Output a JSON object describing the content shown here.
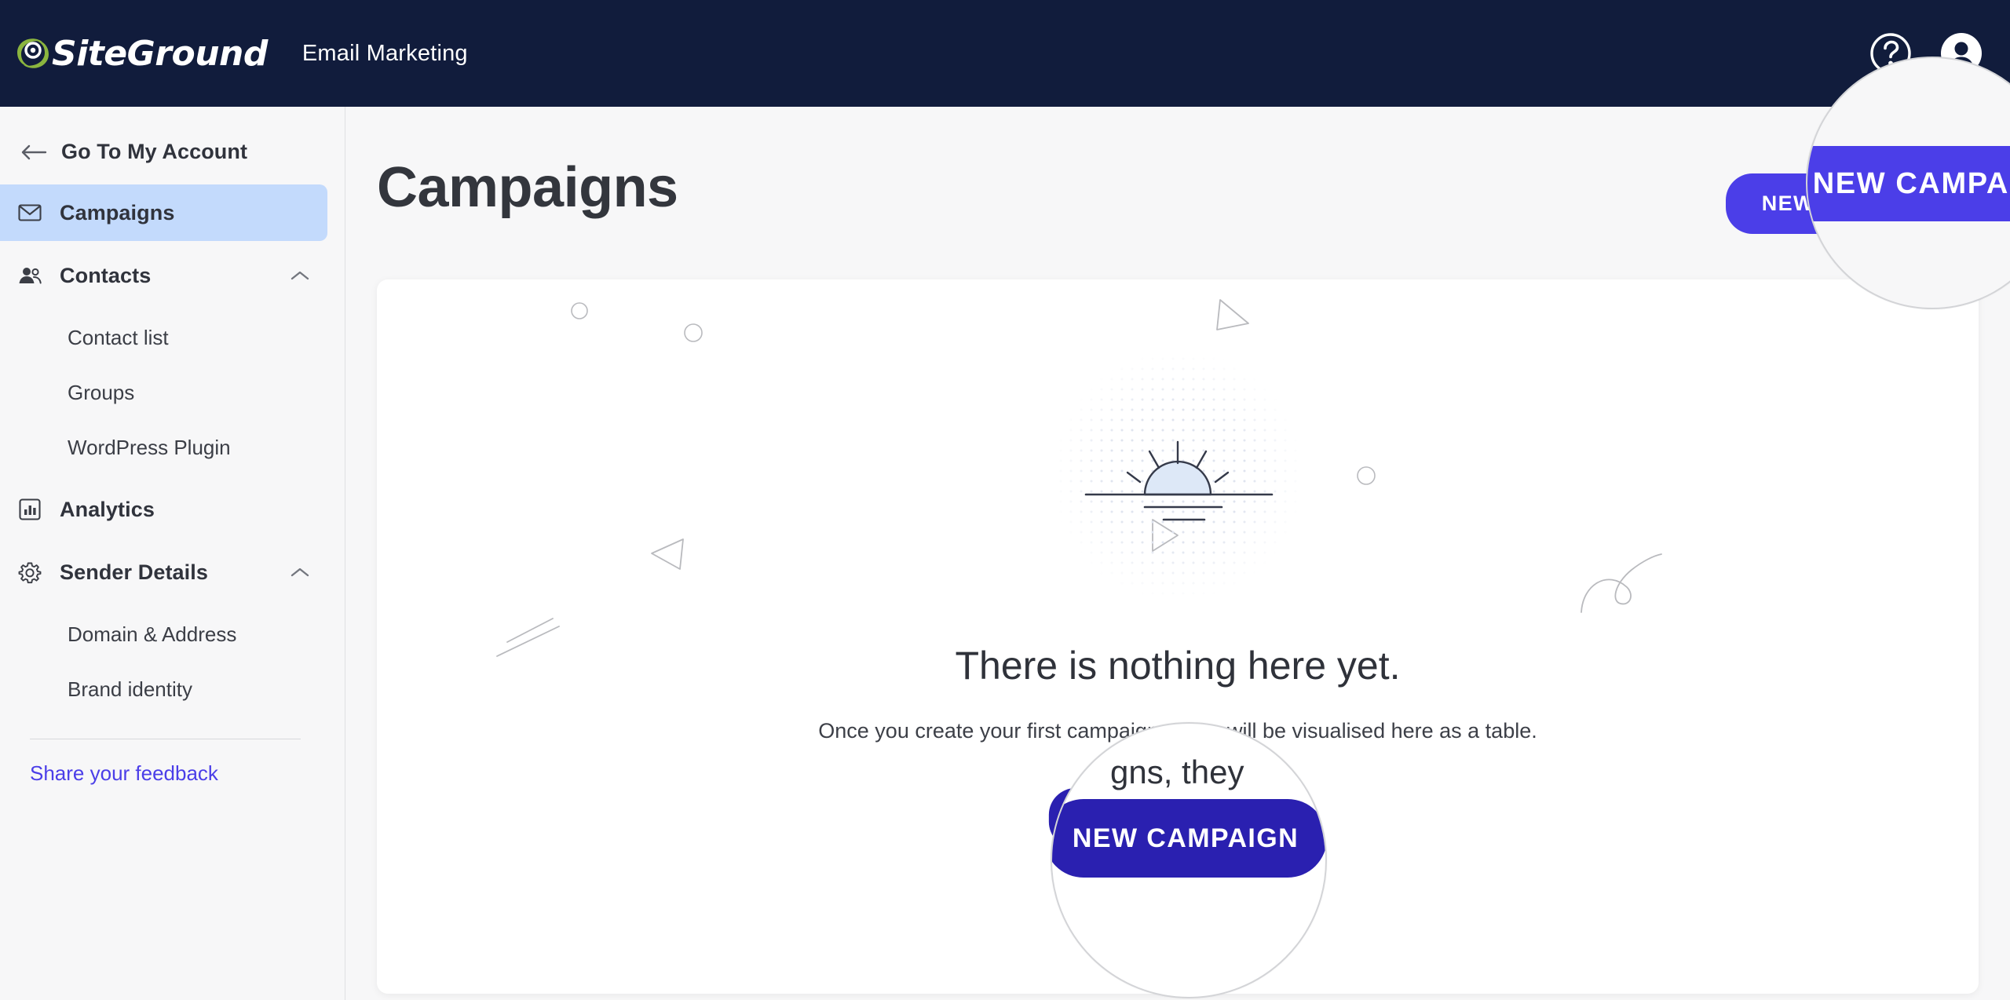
{
  "header": {
    "logo_text": "SiteGround",
    "logo_icon": "siteground-swirl-icon",
    "app_title": "Email Marketing",
    "help_icon": "help-question-icon",
    "avatar_icon": "user-avatar-icon"
  },
  "sidebar": {
    "back_link": "Go To My Account",
    "back_icon": "arrow-left-icon",
    "items": [
      {
        "label": "Campaigns",
        "icon": "envelope-icon",
        "active": true
      },
      {
        "label": "Contacts",
        "icon": "people-icon",
        "chevron": "chevron-up-icon"
      },
      {
        "label": "Contact list",
        "sub": true
      },
      {
        "label": "Groups",
        "sub": true
      },
      {
        "label": "WordPress Plugin",
        "sub": true
      },
      {
        "label": "Analytics",
        "icon": "bar-chart-icon"
      },
      {
        "label": "Sender Details",
        "icon": "gear-icon",
        "chevron": "chevron-up-icon"
      },
      {
        "label": "Domain & Address",
        "sub": true
      },
      {
        "label": "Brand identity",
        "sub": true
      }
    ],
    "feedback_link": "Share your feedback"
  },
  "main": {
    "page_title": "Campaigns",
    "new_campaign_top": "NEW CAMPAIGN",
    "empty_title": "There is nothing here yet.",
    "empty_subtitle": "Once you create your first campaigns, they will be visualised here as a table.",
    "empty_subtitle_visible_left": "Once you create your first",
    "empty_subtitle_visible_right": "isualised here as a table.",
    "new_campaign_center": "NEW CAMPAIGN",
    "illustration": "sunrise-illustration"
  },
  "lenses": {
    "top": {
      "name": "magnifier-lens-top",
      "button_label": "NEW CAMPAIGN"
    },
    "bottom": {
      "name": "magnifier-lens-bottom",
      "button_label": "NEW CAMPAIGN",
      "background_fragment": "gns, they"
    }
  },
  "colors": {
    "header_bg": "#111c3c",
    "accent_purple": "#4b3ee8",
    "accent_deep_blue": "#2a20b0",
    "active_nav_bg": "#c3dafc",
    "page_bg": "#f7f7f8",
    "logo_green": "#8bb53f"
  }
}
